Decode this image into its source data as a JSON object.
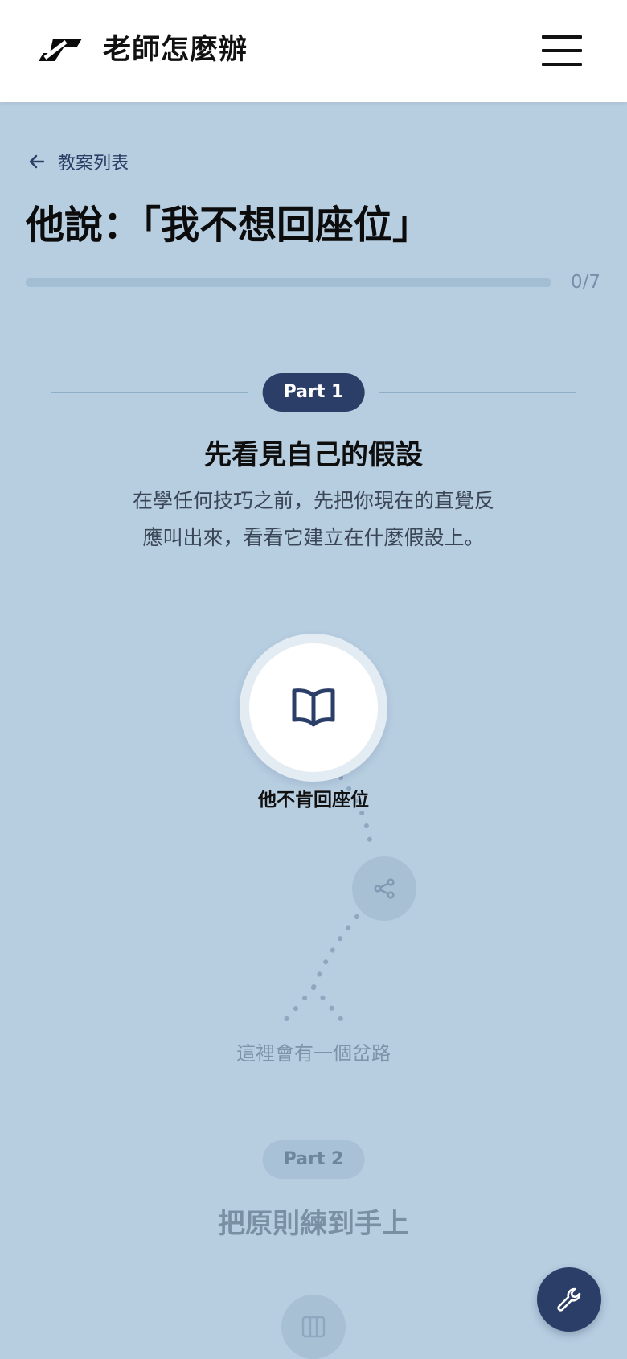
{
  "app": {
    "title": "老師怎麼辦"
  },
  "nav": {
    "back_label": "教案列表"
  },
  "lesson": {
    "title": "他說：「我不想回座位」",
    "progress_text": "0/7",
    "progress_fraction": 0
  },
  "parts": [
    {
      "label": "Part 1",
      "title": "先看見自己的假設",
      "description": "在學任何技巧之前，先把你現在的直覺反應叫出來，看看它建立在什麼假設上。",
      "nodes": [
        {
          "label": "他不肯回座位",
          "icon": "open-book-icon",
          "state": "current"
        },
        {
          "label": "",
          "icon": "branch-icon",
          "state": "locked"
        }
      ],
      "fork_hint": "這裡會有一個岔路"
    },
    {
      "label": "Part 2",
      "title": "把原則練到手上",
      "nodes": [
        {
          "label": "",
          "icon": "columns-icon",
          "state": "locked"
        }
      ]
    }
  ],
  "icons": {
    "logo": "brand-logo",
    "menu": "hamburger-menu-icon",
    "back": "arrow-left-icon",
    "fab": "wrench-icon"
  },
  "colors": {
    "background": "#b7cde0",
    "accent": "#2a3e68",
    "header": "#ffffff"
  }
}
